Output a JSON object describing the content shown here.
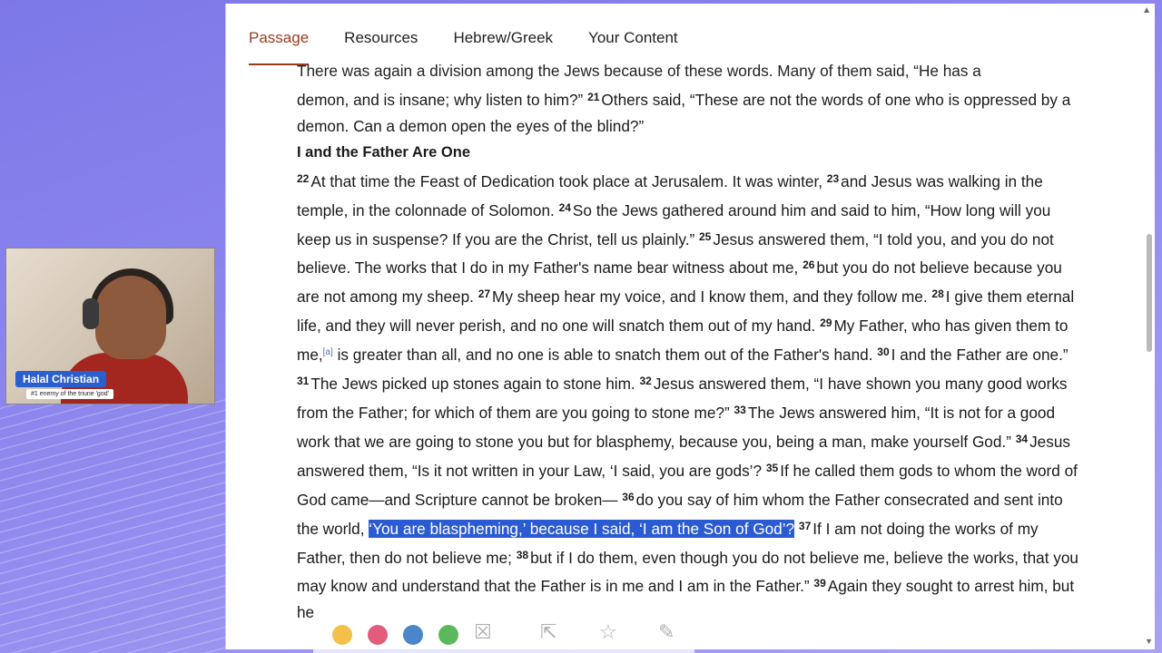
{
  "tabs": [
    {
      "label": "Passage",
      "active": true
    },
    {
      "label": "Resources",
      "active": false
    },
    {
      "label": "Hebrew/Greek",
      "active": false
    },
    {
      "label": "Your Content",
      "active": false
    }
  ],
  "passage": {
    "top_fragment": "There was again a division among the Jews because of these words. Many of them said, “He has a",
    "p1": {
      "t1": "demon, and is insane; why listen to him?”",
      "v21": "21",
      "t2": "Others said, “These are not the words of one who is oppressed by a demon. Can a demon open the eyes of the blind?”"
    },
    "heading": "I and the Father Are One",
    "p2": {
      "v22": "22",
      "t22": "At that time the Feast of Dedication took place at Jerusalem. It was winter,",
      "v23": "23",
      "t23": "and Jesus was walking in the temple, in the colonnade of Solomon.",
      "v24": "24",
      "t24": "So the Jews gathered around him and said to him, “How long will you keep us in suspense? If you are the Christ, tell us plainly.”",
      "v25": "25",
      "t25": "Jesus answered them, “I told you, and you do not believe. The works that I do in my Father's name bear witness about me,",
      "v26": "26",
      "t26": "but you do not believe because you are not among my sheep.",
      "v27": "27",
      "t27": "My sheep hear my voice, and I know them, and they follow me.",
      "v28": "28",
      "t28": "I give them eternal life, and they will never perish, and no one will snatch them out of my hand.",
      "v29": "29",
      "t29a": "My Father, who has given them to me,",
      "fn": "[a]",
      "t29b": "is greater than all, and no one is able to snatch them out of the Father's hand.",
      "v30": "30",
      "t30": "I and the Father are one.”"
    },
    "p3": {
      "v31": "31",
      "t31": "The Jews picked up stones again to stone him.",
      "v32": "32",
      "t32": "Jesus answered them, “I have shown you many good works from the Father; for which of them are you going to stone me?”",
      "v33": "33",
      "t33": "The Jews answered him, “It is not for a good work that we are going to stone you but for blasphemy, because you, being a man, make yourself God.”",
      "v34": "34",
      "t34": "Jesus answered them, “Is it not written in your Law, ‘I said, you are gods’?",
      "v35": "35",
      "t35": "If he called them gods to whom the word of God came—and Scripture cannot be broken—",
      "v36": "36",
      "t36a": "do you say of him whom the Father consecrated and sent into the world,",
      "t36hl": "‘You are blaspheming,’ because I said, ‘I am the Son of God’?",
      "v37": "37",
      "t37": "If I am not doing the works of my Father, then do not believe me;",
      "v38": "38",
      "t38": "but if I do them, even though you do not believe me, believe the works, that you may know and understand that the Father is in me and I am in the Father.”",
      "v39": "39",
      "t39": "Again they sought to arrest him, but he"
    }
  },
  "webcam": {
    "name": "Halal Christian",
    "subtitle": "#1 enemy of the triune 'god'"
  },
  "annotation_toolbar": {
    "colors": [
      "#f5c04a",
      "#e45c7c",
      "#4a86c8",
      "#5cb85c"
    ],
    "icons": [
      "close-icon",
      "share-icon",
      "star-icon",
      "edit-icon"
    ]
  },
  "icon_glyphs": {
    "close": "☒",
    "share": "⇱",
    "star": "☆",
    "edit": "✎"
  }
}
